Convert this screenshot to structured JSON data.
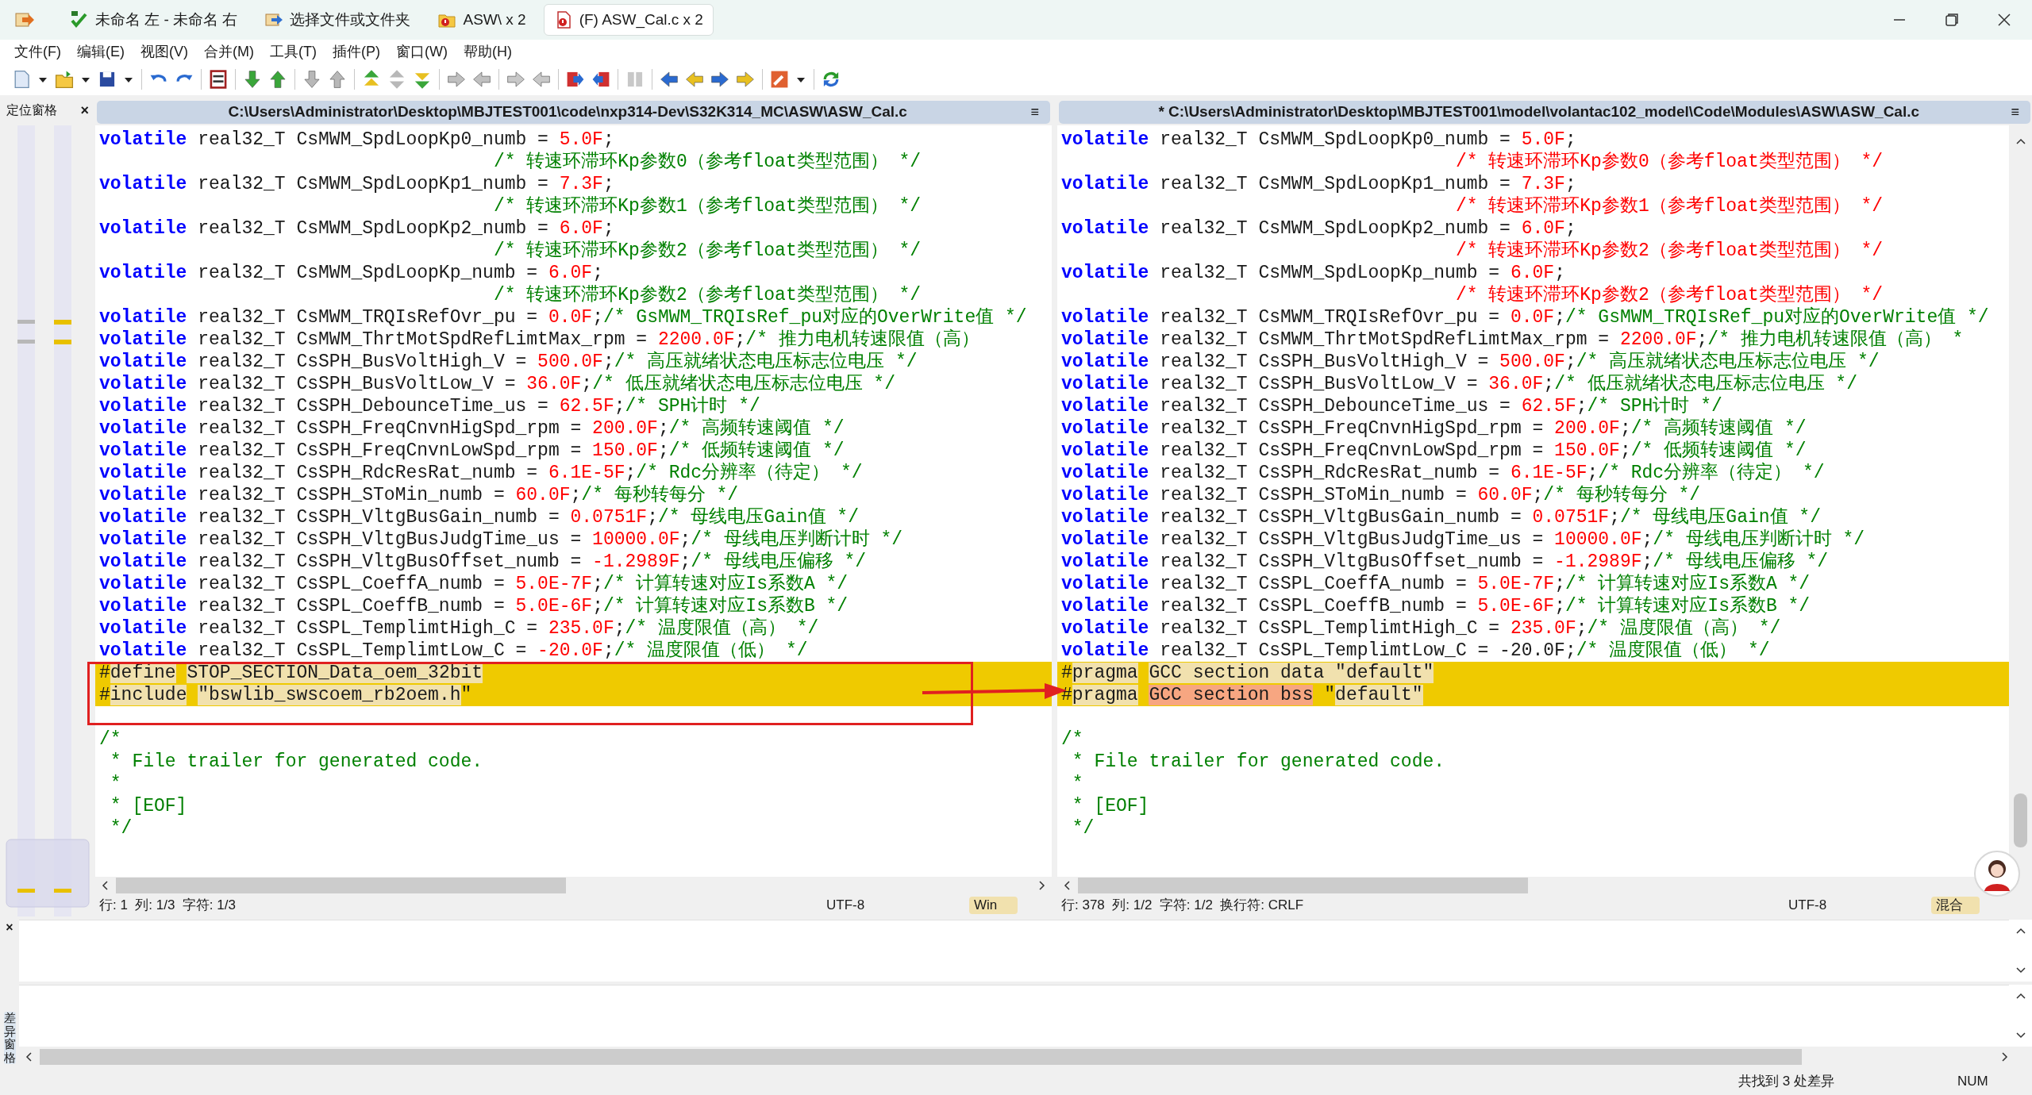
{
  "tabs": [
    {
      "label": "未命名 左 - 未命名 右",
      "kind": "compare",
      "selected": false
    },
    {
      "label": "选择文件或文件夹",
      "kind": "open",
      "selected": false
    },
    {
      "label": "ASW\\ x 2",
      "kind": "folder",
      "selected": false
    },
    {
      "label": "(F) ASW_Cal.c x 2",
      "kind": "file",
      "selected": true
    }
  ],
  "menu": [
    "文件(F)",
    "编辑(E)",
    "视图(V)",
    "合并(M)",
    "工具(T)",
    "插件(P)",
    "窗口(W)",
    "帮助(H)"
  ],
  "location_pane": {
    "title": "定位窗格",
    "close": "×"
  },
  "panes": [
    {
      "path": "C:\\Users\\Administrator\\Desktop\\MBJTEST001\\code\\nxp314-Dev\\S32K314_MC\\ASW\\ASW_Cal.c",
      "menu_glyph": "≡",
      "lines": [
        {
          "kind": "code",
          "segs": [
            {
              "kind": "keyword",
              "text": "volatile"
            },
            {
              "kind": "text",
              "text": " real32_T CsMWM_SpdLoopKp0_numb = "
            },
            {
              "kind": "literal",
              "text": "5.0F"
            },
            {
              "kind": "text",
              "text": ";"
            }
          ]
        },
        {
          "kind": "continuation",
          "segs": [
            {
              "kind": "comment",
              "text": "/* 转速环滞环Kp参数0（参考float类型范围） */"
            }
          ]
        },
        {
          "kind": "code",
          "segs": [
            {
              "kind": "keyword",
              "text": "volatile"
            },
            {
              "kind": "text",
              "text": " real32_T CsMWM_SpdLoopKp1_numb = "
            },
            {
              "kind": "literal",
              "text": "7.3F"
            },
            {
              "kind": "text",
              "text": ";"
            }
          ]
        },
        {
          "kind": "continuation",
          "segs": [
            {
              "kind": "comment",
              "text": "/* 转速环滞环Kp参数1（参考float类型范围） */"
            }
          ]
        },
        {
          "kind": "code",
          "segs": [
            {
              "kind": "keyword",
              "text": "volatile"
            },
            {
              "kind": "text",
              "text": " real32_T CsMWM_SpdLoopKp2_numb = "
            },
            {
              "kind": "literal",
              "text": "6.0F"
            },
            {
              "kind": "text",
              "text": ";"
            }
          ]
        },
        {
          "kind": "continuation",
          "segs": [
            {
              "kind": "comment",
              "text": "/* 转速环滞环Kp参数2（参考float类型范围） */"
            }
          ]
        },
        {
          "kind": "code",
          "segs": [
            {
              "kind": "keyword",
              "text": "volatile"
            },
            {
              "kind": "text",
              "text": " real32_T CsMWM_SpdLoopKp_numb = "
            },
            {
              "kind": "literal",
              "text": "6.0F"
            },
            {
              "kind": "text",
              "text": ";"
            }
          ]
        },
        {
          "kind": "continuation",
          "segs": [
            {
              "kind": "comment",
              "text": "/* 转速环滞环Kp参数2（参考float类型范围） */"
            }
          ]
        },
        {
          "kind": "code",
          "segs": [
            {
              "kind": "keyword",
              "text": "volatile"
            },
            {
              "kind": "text",
              "text": " real32_T CsMWM_TRQIsRefOvr_pu = "
            },
            {
              "kind": "literal",
              "text": "0.0F"
            },
            {
              "kind": "text",
              "text": ";"
            },
            {
              "kind": "comment",
              "text": "/* GsMWM_TRQIsRef_pu对应的OverWrite值 */"
            }
          ]
        },
        {
          "kind": "code",
          "segs": [
            {
              "kind": "keyword",
              "text": "volatile"
            },
            {
              "kind": "text",
              "text": " real32_T CsMWM_ThrtMotSpdRefLimtMax_rpm = "
            },
            {
              "kind": "literal",
              "text": "2200.0F"
            },
            {
              "kind": "text",
              "text": ";"
            },
            {
              "kind": "comment",
              "text": "/* 推力电机转速限值（高）"
            }
          ]
        },
        {
          "kind": "code",
          "segs": [
            {
              "kind": "keyword",
              "text": "volatile"
            },
            {
              "kind": "text",
              "text": " real32_T CsSPH_BusVoltHigh_V = "
            },
            {
              "kind": "literal",
              "text": "500.0F"
            },
            {
              "kind": "text",
              "text": ";"
            },
            {
              "kind": "comment",
              "text": "/* 高压就绪状态电压标志位电压 */"
            }
          ]
        },
        {
          "kind": "code",
          "segs": [
            {
              "kind": "keyword",
              "text": "volatile"
            },
            {
              "kind": "text",
              "text": " real32_T CsSPH_BusVoltLow_V = "
            },
            {
              "kind": "literal",
              "text": "36.0F"
            },
            {
              "kind": "text",
              "text": ";"
            },
            {
              "kind": "comment",
              "text": "/* 低压就绪状态电压标志位电压 */"
            }
          ]
        },
        {
          "kind": "code",
          "segs": [
            {
              "kind": "keyword",
              "text": "volatile"
            },
            {
              "kind": "text",
              "text": " real32_T CsSPH_DebounceTime_us = "
            },
            {
              "kind": "literal",
              "text": "62.5F"
            },
            {
              "kind": "text",
              "text": ";"
            },
            {
              "kind": "comment",
              "text": "/* SPH计时 */"
            }
          ]
        },
        {
          "kind": "code",
          "segs": [
            {
              "kind": "keyword",
              "text": "volatile"
            },
            {
              "kind": "text",
              "text": " real32_T CsSPH_FreqCnvnHigSpd_rpm = "
            },
            {
              "kind": "literal",
              "text": "200.0F"
            },
            {
              "kind": "text",
              "text": ";"
            },
            {
              "kind": "comment",
              "text": "/* 高频转速阈值 */"
            }
          ]
        },
        {
          "kind": "code",
          "segs": [
            {
              "kind": "keyword",
              "text": "volatile"
            },
            {
              "kind": "text",
              "text": " real32_T CsSPH_FreqCnvnLowSpd_rpm = "
            },
            {
              "kind": "literal",
              "text": "150.0F"
            },
            {
              "kind": "text",
              "text": ";"
            },
            {
              "kind": "comment",
              "text": "/* 低频转速阈值 */"
            }
          ]
        },
        {
          "kind": "code",
          "segs": [
            {
              "kind": "keyword",
              "text": "volatile"
            },
            {
              "kind": "text",
              "text": " real32_T CsSPH_RdcResRat_numb = "
            },
            {
              "kind": "literal",
              "text": "6.1E-5F"
            },
            {
              "kind": "text",
              "text": ";"
            },
            {
              "kind": "comment",
              "text": "/* Rdc分辨率（待定） */"
            }
          ]
        },
        {
          "kind": "code",
          "segs": [
            {
              "kind": "keyword",
              "text": "volatile"
            },
            {
              "kind": "text",
              "text": " real32_T CsSPH_SToMin_numb = "
            },
            {
              "kind": "literal",
              "text": "60.0F"
            },
            {
              "kind": "text",
              "text": ";"
            },
            {
              "kind": "comment",
              "text": "/* 每秒转每分 */"
            }
          ]
        },
        {
          "kind": "code",
          "segs": [
            {
              "kind": "keyword",
              "text": "volatile"
            },
            {
              "kind": "text",
              "text": " real32_T CsSPH_VltgBusGain_numb = "
            },
            {
              "kind": "literal",
              "text": "0.0751F"
            },
            {
              "kind": "text",
              "text": ";"
            },
            {
              "kind": "comment",
              "text": "/* 母线电压Gain值 */"
            }
          ]
        },
        {
          "kind": "code",
          "segs": [
            {
              "kind": "keyword",
              "text": "volatile"
            },
            {
              "kind": "text",
              "text": " real32_T CsSPH_VltgBusJudgTime_us = "
            },
            {
              "kind": "literal",
              "text": "10000.0F"
            },
            {
              "kind": "text",
              "text": ";"
            },
            {
              "kind": "comment",
              "text": "/* 母线电压判断计时 */"
            }
          ]
        },
        {
          "kind": "code",
          "segs": [
            {
              "kind": "keyword",
              "text": "volatile"
            },
            {
              "kind": "text",
              "text": " real32_T CsSPH_VltgBusOffset_numb = "
            },
            {
              "kind": "literal",
              "text": "-1.2989F"
            },
            {
              "kind": "text",
              "text": ";"
            },
            {
              "kind": "comment",
              "text": "/* 母线电压偏移 */"
            }
          ]
        },
        {
          "kind": "code",
          "segs": [
            {
              "kind": "keyword",
              "text": "volatile"
            },
            {
              "kind": "text",
              "text": " real32_T CsSPL_CoeffA_numb = "
            },
            {
              "kind": "literal",
              "text": "5.0E-7F"
            },
            {
              "kind": "text",
              "text": ";"
            },
            {
              "kind": "comment",
              "text": "/* 计算转速对应Is系数A */"
            }
          ]
        },
        {
          "kind": "code",
          "segs": [
            {
              "kind": "keyword",
              "text": "volatile"
            },
            {
              "kind": "text",
              "text": " real32_T CsSPL_CoeffB_numb = "
            },
            {
              "kind": "literal",
              "text": "5.0E-6F"
            },
            {
              "kind": "text",
              "text": ";"
            },
            {
              "kind": "comment",
              "text": "/* 计算转速对应Is系数B */"
            }
          ]
        },
        {
          "kind": "code",
          "segs": [
            {
              "kind": "keyword",
              "text": "volatile"
            },
            {
              "kind": "text",
              "text": " real32_T CsSPL_TemplimtHigh_C = "
            },
            {
              "kind": "literal",
              "text": "235.0F"
            },
            {
              "kind": "text",
              "text": ";"
            },
            {
              "kind": "comment",
              "text": "/* 温度限值（高） */"
            }
          ]
        },
        {
          "kind": "code",
          "segs": [
            {
              "kind": "keyword",
              "text": "volatile"
            },
            {
              "kind": "text",
              "text": " real32_T CsSPL_TemplimtLow_C = "
            },
            {
              "kind": "literal",
              "text": "-20.0F"
            },
            {
              "kind": "text",
              "text": ";"
            },
            {
              "kind": "comment",
              "text": "/* 温度限值（低） */"
            }
          ]
        },
        {
          "kind": "diff",
          "segs": [
            {
              "kind": "text",
              "text": "#"
            },
            {
              "kind": "diff_word",
              "text": "define"
            },
            {
              "kind": "diff_word",
              "text": "STOP_SECTION_Data_oem_32bit"
            }
          ]
        },
        {
          "kind": "diff",
          "segs": [
            {
              "kind": "text",
              "text": "#"
            },
            {
              "kind": "diff_word",
              "text": "include"
            },
            {
              "kind": "diff_word",
              "text": "\"bswlib_swscoem_rb2oem.h"
            },
            {
              "kind": "text",
              "text": "\""
            }
          ]
        },
        {
          "kind": "blank"
        },
        {
          "kind": "code",
          "segs": [
            {
              "kind": "comment",
              "text": "/*"
            }
          ]
        },
        {
          "kind": "code",
          "segs": [
            {
              "kind": "comment",
              "text": " * File trailer for generated code."
            }
          ]
        },
        {
          "kind": "code",
          "segs": [
            {
              "kind": "comment",
              "text": " *"
            }
          ]
        },
        {
          "kind": "code",
          "segs": [
            {
              "kind": "comment",
              "text": " * [EOF]"
            }
          ]
        },
        {
          "kind": "code",
          "segs": [
            {
              "kind": "comment",
              "text": " */"
            }
          ]
        }
      ],
      "status": {
        "position": "行: 1  列: 1/3  字符: 1/3",
        "encoding": "UTF-8",
        "eol": "Win"
      }
    },
    {
      "path": "* C:\\Users\\Administrator\\Desktop\\MBJTEST001\\model\\volantac102_model\\Code\\Modules\\ASW\\ASW_Cal.c",
      "menu_glyph": "≡",
      "lines": [
        {
          "kind": "code",
          "segs": [
            {
              "kind": "keyword",
              "text": "volatile"
            },
            {
              "kind": "text",
              "text": " real32_T CsMWM_SpdLoopKp0_numb = "
            },
            {
              "kind": "literal",
              "text": "5.0F"
            },
            {
              "kind": "text",
              "text": ";"
            }
          ]
        },
        {
          "kind": "continuation",
          "segs": [
            {
              "kind": "literal",
              "text": "/* 转速环滞环Kp参数0（参考float类型范围） */"
            }
          ]
        },
        {
          "kind": "code",
          "segs": [
            {
              "kind": "keyword",
              "text": "volatile"
            },
            {
              "kind": "text",
              "text": " real32_T CsMWM_SpdLoopKp1_numb = "
            },
            {
              "kind": "literal",
              "text": "7.3F"
            },
            {
              "kind": "text",
              "text": ";"
            }
          ]
        },
        {
          "kind": "continuation",
          "segs": [
            {
              "kind": "literal",
              "text": "/* 转速环滞环Kp参数1（参考float类型范围） */"
            }
          ]
        },
        {
          "kind": "code",
          "segs": [
            {
              "kind": "keyword",
              "text": "volatile"
            },
            {
              "kind": "text",
              "text": " real32_T CsMWM_SpdLoopKp2_numb = "
            },
            {
              "kind": "literal",
              "text": "6.0F"
            },
            {
              "kind": "text",
              "text": ";"
            }
          ]
        },
        {
          "kind": "continuation",
          "segs": [
            {
              "kind": "literal",
              "text": "/* 转速环滞环Kp参数2（参考float类型范围） */"
            }
          ]
        },
        {
          "kind": "code",
          "segs": [
            {
              "kind": "keyword",
              "text": "volatile"
            },
            {
              "kind": "text",
              "text": " real32_T CsMWM_SpdLoopKp_numb = "
            },
            {
              "kind": "literal",
              "text": "6.0F"
            },
            {
              "kind": "text",
              "text": ";"
            }
          ]
        },
        {
          "kind": "continuation",
          "segs": [
            {
              "kind": "literal",
              "text": "/* 转速环滞环Kp参数2（参考float类型范围） */"
            }
          ]
        },
        {
          "kind": "code",
          "segs": [
            {
              "kind": "keyword",
              "text": "volatile"
            },
            {
              "kind": "text",
              "text": " real32_T CsMWM_TRQIsRefOvr_pu = "
            },
            {
              "kind": "literal",
              "text": "0.0F"
            },
            {
              "kind": "text",
              "text": ";"
            },
            {
              "kind": "comment",
              "text": "/* GsMWM_TRQIsRef_pu对应的OverWrite值 */"
            }
          ]
        },
        {
          "kind": "code",
          "segs": [
            {
              "kind": "keyword",
              "text": "volatile"
            },
            {
              "kind": "text",
              "text": " real32_T CsMWM_ThrtMotSpdRefLimtMax_rpm = "
            },
            {
              "kind": "literal",
              "text": "2200.0F"
            },
            {
              "kind": "text",
              "text": ";"
            },
            {
              "kind": "comment",
              "text": "/* 推力电机转速限值（高） *"
            }
          ]
        },
        {
          "kind": "code",
          "segs": [
            {
              "kind": "keyword",
              "text": "volatile"
            },
            {
              "kind": "text",
              "text": " real32_T CsSPH_BusVoltHigh_V = "
            },
            {
              "kind": "literal",
              "text": "500.0F"
            },
            {
              "kind": "text",
              "text": ";"
            },
            {
              "kind": "comment",
              "text": "/* 高压就绪状态电压标志位电压 */"
            }
          ]
        },
        {
          "kind": "code",
          "segs": [
            {
              "kind": "keyword",
              "text": "volatile"
            },
            {
              "kind": "text",
              "text": " real32_T CsSPH_BusVoltLow_V = "
            },
            {
              "kind": "literal",
              "text": "36.0F"
            },
            {
              "kind": "text",
              "text": ";"
            },
            {
              "kind": "comment",
              "text": "/* 低压就绪状态电压标志位电压 */"
            }
          ]
        },
        {
          "kind": "code",
          "segs": [
            {
              "kind": "keyword",
              "text": "volatile"
            },
            {
              "kind": "text",
              "text": " real32_T CsSPH_DebounceTime_us = "
            },
            {
              "kind": "literal",
              "text": "62.5F"
            },
            {
              "kind": "text",
              "text": ";"
            },
            {
              "kind": "comment",
              "text": "/* SPH计时 */"
            }
          ]
        },
        {
          "kind": "code",
          "segs": [
            {
              "kind": "keyword",
              "text": "volatile"
            },
            {
              "kind": "text",
              "text": " real32_T CsSPH_FreqCnvnHigSpd_rpm = "
            },
            {
              "kind": "literal",
              "text": "200.0F"
            },
            {
              "kind": "text",
              "text": ";"
            },
            {
              "kind": "comment",
              "text": "/* 高频转速阈值 */"
            }
          ]
        },
        {
          "kind": "code",
          "segs": [
            {
              "kind": "keyword",
              "text": "volatile"
            },
            {
              "kind": "text",
              "text": " real32_T CsSPH_FreqCnvnLowSpd_rpm = "
            },
            {
              "kind": "literal",
              "text": "150.0F"
            },
            {
              "kind": "text",
              "text": ";"
            },
            {
              "kind": "comment",
              "text": "/* 低频转速阈值 */"
            }
          ]
        },
        {
          "kind": "code",
          "segs": [
            {
              "kind": "keyword",
              "text": "volatile"
            },
            {
              "kind": "text",
              "text": " real32_T CsSPH_RdcResRat_numb = "
            },
            {
              "kind": "literal",
              "text": "6.1E-5F"
            },
            {
              "kind": "text",
              "text": ";"
            },
            {
              "kind": "comment",
              "text": "/* Rdc分辨率（待定） */"
            }
          ]
        },
        {
          "kind": "code",
          "segs": [
            {
              "kind": "keyword",
              "text": "volatile"
            },
            {
              "kind": "text",
              "text": " real32_T CsSPH_SToMin_numb = "
            },
            {
              "kind": "literal",
              "text": "60.0F"
            },
            {
              "kind": "text",
              "text": ";"
            },
            {
              "kind": "comment",
              "text": "/* 每秒转每分 */"
            }
          ]
        },
        {
          "kind": "code",
          "segs": [
            {
              "kind": "keyword",
              "text": "volatile"
            },
            {
              "kind": "text",
              "text": " real32_T CsSPH_VltgBusGain_numb = "
            },
            {
              "kind": "literal",
              "text": "0.0751F"
            },
            {
              "kind": "text",
              "text": ";"
            },
            {
              "kind": "comment",
              "text": "/* 母线电压Gain值 */"
            }
          ]
        },
        {
          "kind": "code",
          "segs": [
            {
              "kind": "keyword",
              "text": "volatile"
            },
            {
              "kind": "text",
              "text": " real32_T CsSPH_VltgBusJudgTime_us = "
            },
            {
              "kind": "literal",
              "text": "10000.0F"
            },
            {
              "kind": "text",
              "text": ";"
            },
            {
              "kind": "comment",
              "text": "/* 母线电压判断计时 */"
            }
          ]
        },
        {
          "kind": "code",
          "segs": [
            {
              "kind": "keyword",
              "text": "volatile"
            },
            {
              "kind": "text",
              "text": " real32_T CsSPH_VltgBusOffset_numb = "
            },
            {
              "kind": "literal",
              "text": "-1.2989F"
            },
            {
              "kind": "text",
              "text": ";"
            },
            {
              "kind": "comment",
              "text": "/* 母线电压偏移 */"
            }
          ]
        },
        {
          "kind": "code",
          "segs": [
            {
              "kind": "keyword",
              "text": "volatile"
            },
            {
              "kind": "text",
              "text": " real32_T CsSPL_CoeffA_numb = "
            },
            {
              "kind": "literal",
              "text": "5.0E-7F"
            },
            {
              "kind": "text",
              "text": ";"
            },
            {
              "kind": "comment",
              "text": "/* 计算转速对应Is系数A */"
            }
          ]
        },
        {
          "kind": "code",
          "segs": [
            {
              "kind": "keyword",
              "text": "volatile"
            },
            {
              "kind": "text",
              "text": " real32_T CsSPL_CoeffB_numb = "
            },
            {
              "kind": "literal",
              "text": "5.0E-6F"
            },
            {
              "kind": "text",
              "text": ";"
            },
            {
              "kind": "comment",
              "text": "/* 计算转速对应Is系数B */"
            }
          ]
        },
        {
          "kind": "code",
          "segs": [
            {
              "kind": "keyword",
              "text": "volatile"
            },
            {
              "kind": "text",
              "text": " real32_T CsSPL_TemplimtHigh_C = "
            },
            {
              "kind": "literal",
              "text": "235.0F"
            },
            {
              "kind": "text",
              "text": ";"
            },
            {
              "kind": "comment",
              "text": "/* 温度限值（高） */"
            }
          ]
        },
        {
          "kind": "code",
          "segs": [
            {
              "kind": "keyword",
              "text": "volatile"
            },
            {
              "kind": "text",
              "text": " real32_T CsSPL_TemplimtLow_C = -20.0F;"
            },
            {
              "kind": "comment",
              "text": "/* 温度限值（低） */"
            }
          ]
        },
        {
          "kind": "diff",
          "segs": [
            {
              "kind": "text",
              "text": "#"
            },
            {
              "kind": "diff_word",
              "text": "pragma"
            },
            {
              "kind": "diff_word",
              "text": "GCC section data \"default\""
            }
          ]
        },
        {
          "kind": "diff",
          "segs": [
            {
              "kind": "text",
              "text": "#"
            },
            {
              "kind": "diff_word",
              "text": "pragma"
            },
            {
              "kind": "diff_change",
              "text": "GCC section bss"
            },
            {
              "kind": "text",
              "text": " \""
            },
            {
              "kind": "diff_word",
              "text": "default\""
            }
          ]
        },
        {
          "kind": "blank"
        },
        {
          "kind": "code",
          "segs": [
            {
              "kind": "comment",
              "text": "/*"
            }
          ]
        },
        {
          "kind": "code",
          "segs": [
            {
              "kind": "comment",
              "text": " * File trailer for generated code."
            }
          ]
        },
        {
          "kind": "code",
          "segs": [
            {
              "kind": "comment",
              "text": " *"
            }
          ]
        },
        {
          "kind": "code",
          "segs": [
            {
              "kind": "comment",
              "text": " * [EOF]"
            }
          ]
        },
        {
          "kind": "code",
          "segs": [
            {
              "kind": "comment",
              "text": " */"
            }
          ]
        }
      ],
      "status": {
        "position": "行: 378  列: 1/2  字符: 1/2  换行符: CRLF",
        "encoding": "UTF-8",
        "eol": "混合"
      }
    }
  ],
  "diff_pane": {
    "title": "差异窗格",
    "close": "×"
  },
  "status_bar": {
    "message": "共找到 3 处差异",
    "mode": "NUM"
  }
}
